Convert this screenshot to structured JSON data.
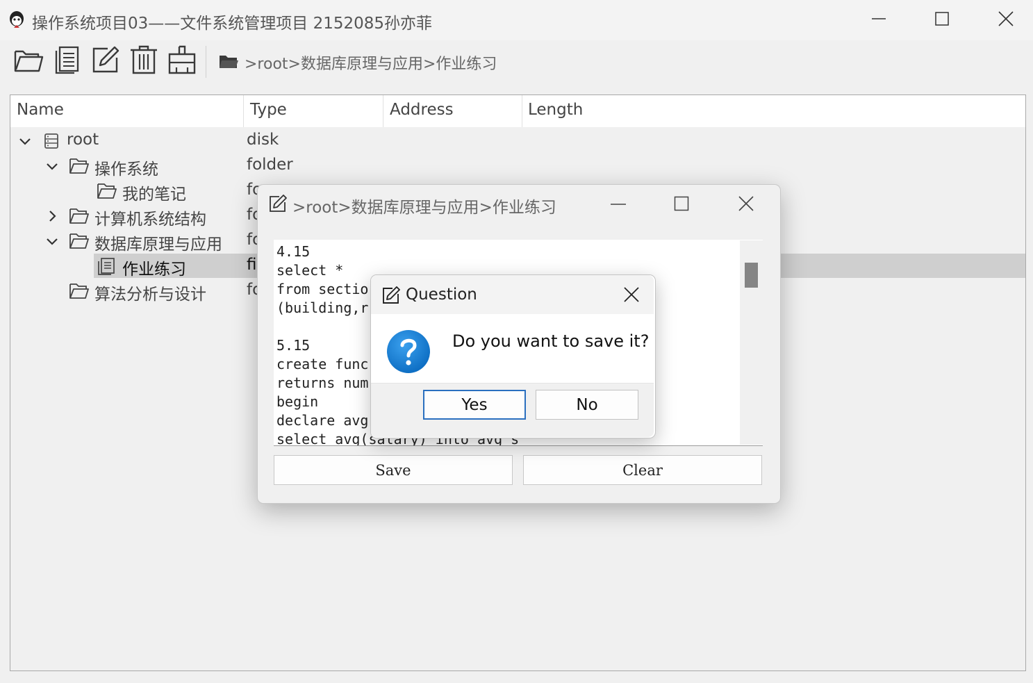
{
  "window": {
    "title": "操作系统项目03——文件系统管理项目  2152085孙亦菲",
    "controls": [
      "minimize",
      "maximize",
      "close"
    ]
  },
  "toolbar": {
    "buttons": [
      {
        "icon": "folder-open-icon"
      },
      {
        "icon": "document-icon"
      },
      {
        "icon": "edit-icon"
      },
      {
        "icon": "trash-icon"
      },
      {
        "icon": "format-disk-icon"
      }
    ],
    "path_icon": "folder-icon",
    "path": ">root>数据库原理与应用>作业练习"
  },
  "tree": {
    "columns": [
      "Name",
      "Type",
      "Address",
      "Length"
    ],
    "rows": [
      {
        "name": "root",
        "type": "disk",
        "icon": "disk-icon",
        "expander": "expanded"
      },
      {
        "name": "操作系统",
        "type": "folder",
        "icon": "folder-icon",
        "expander": "expanded"
      },
      {
        "name": "我的笔记",
        "type": "fo",
        "icon": "folder-icon",
        "expander": "none"
      },
      {
        "name": "计算机系统结构",
        "type": "fo",
        "icon": "folder-icon",
        "expander": "collapsed"
      },
      {
        "name": "数据库原理与应用",
        "type": "fo",
        "icon": "folder-icon",
        "expander": "expanded"
      },
      {
        "name": "作业练习",
        "type": "fi",
        "icon": "document-icon",
        "expander": "none",
        "selected": true
      },
      {
        "name": "算法分析与设计",
        "type": "fo",
        "icon": "folder-icon",
        "expander": "none"
      }
    ]
  },
  "editor": {
    "title": ">root>数据库原理与应用>作业练习",
    "content": "4.15\nselect *\nfrom sectio\n(building,r\n\n5.15\ncreate func\nreturns num\nbegin\ndeclare avg\nselect avg(salary) into avg_s",
    "save_label": "Save",
    "clear_label": "Clear"
  },
  "question": {
    "title": "Question",
    "message": "Do you want to save it?",
    "yes_label": "Yes",
    "no_label": "No"
  },
  "colors": {
    "question_icon": "#1a7fd4",
    "selection": "#cfcfcf",
    "default_button_border": "#2a6fbf"
  }
}
